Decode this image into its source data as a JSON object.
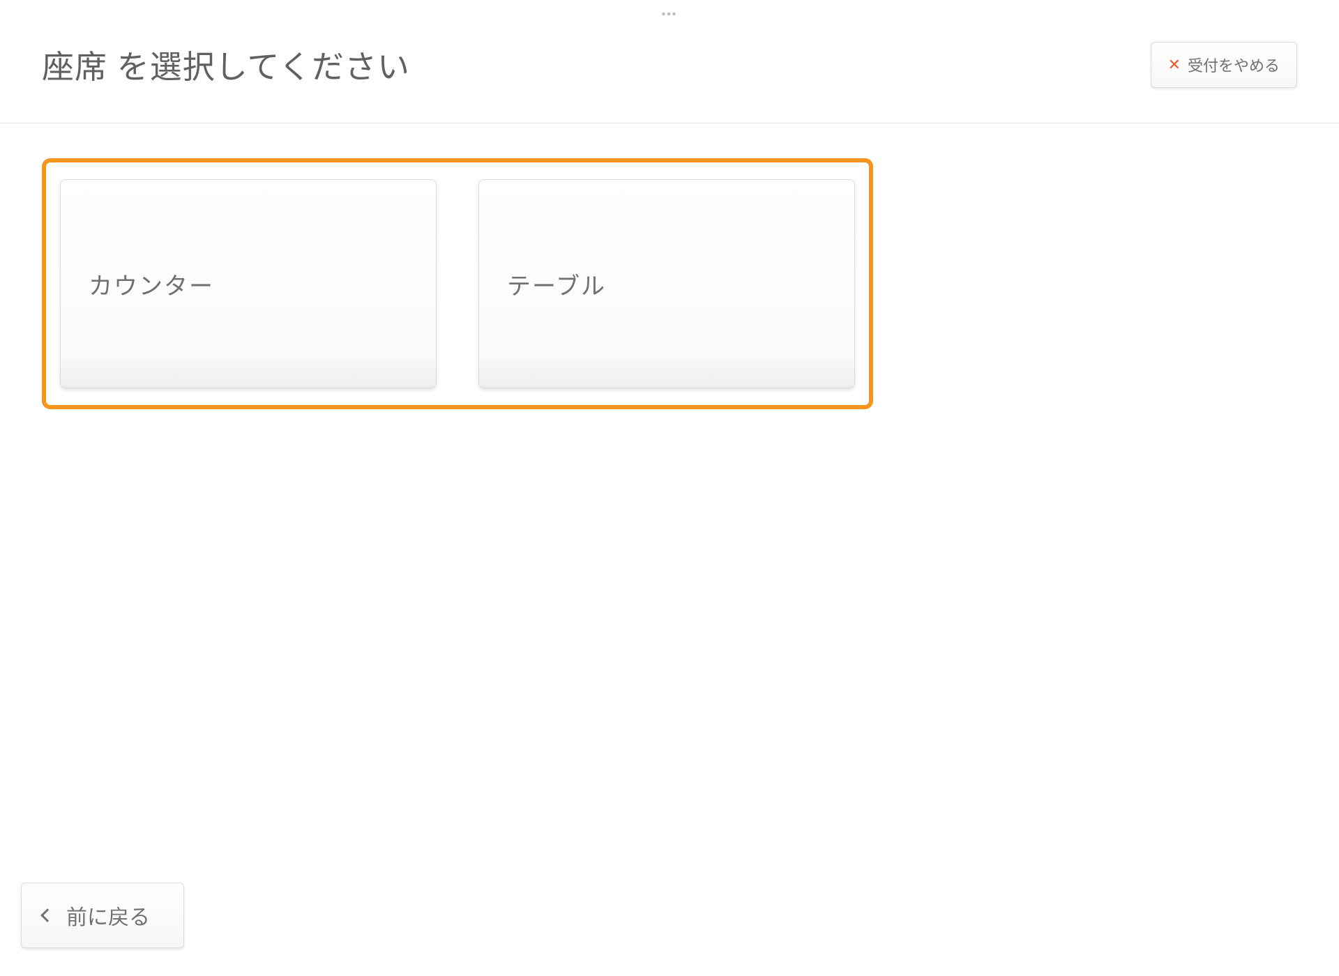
{
  "header": {
    "title": "座席 を選択してください",
    "cancel_label": "受付をやめる"
  },
  "options": [
    {
      "label": "カウンター"
    },
    {
      "label": "テーブル"
    }
  ],
  "footer": {
    "back_label": "前に戻る"
  },
  "colors": {
    "highlight": "#f7941e",
    "accent": "#e85c2a"
  }
}
